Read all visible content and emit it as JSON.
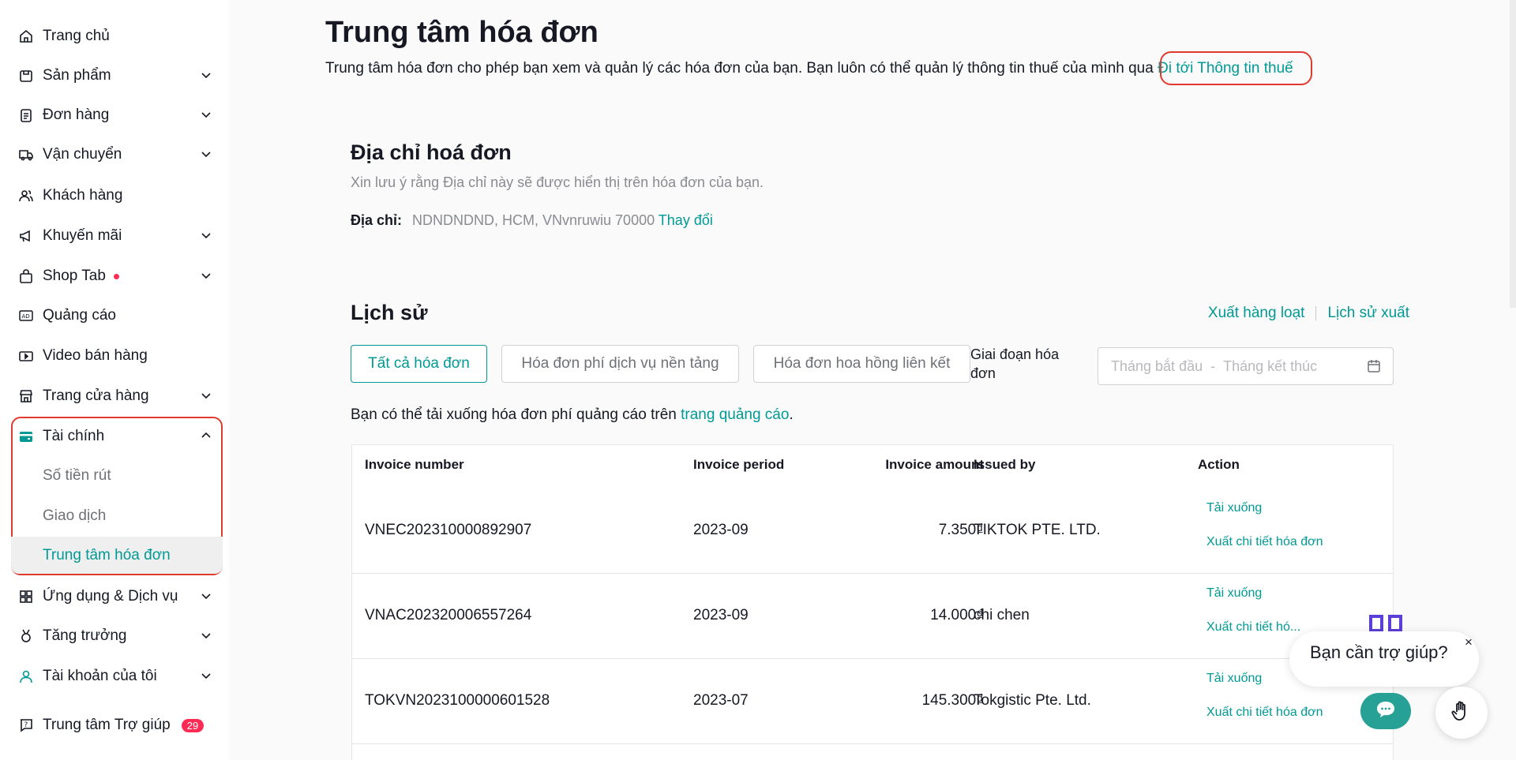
{
  "sidebar": {
    "items": [
      {
        "label": "Trang chủ",
        "icon": "home-icon"
      },
      {
        "label": "Sản phẩm",
        "icon": "product-icon"
      },
      {
        "label": "Đơn hàng",
        "icon": "order-icon"
      },
      {
        "label": "Vận chuyển",
        "icon": "truck-icon"
      },
      {
        "label": "Khách hàng",
        "icon": "customers-icon"
      },
      {
        "label": "Khuyến mãi",
        "icon": "megaphone-icon"
      },
      {
        "label": "Shop Tab",
        "icon": "shop-bag-icon"
      },
      {
        "label": "Quảng cáo",
        "icon": "ad-icon"
      },
      {
        "label": "Video bán hàng",
        "icon": "video-icon"
      },
      {
        "label": "Trang cửa hàng",
        "icon": "storefront-icon"
      },
      {
        "label": "Tài chính",
        "icon": "wallet-icon"
      },
      {
        "label": "Ứng dụng & Dịch vụ",
        "icon": "apps-icon"
      },
      {
        "label": "Tăng trưởng",
        "icon": "growth-medal-icon"
      },
      {
        "label": "Tài khoản của tôi",
        "icon": "account-icon"
      },
      {
        "label": "Trung tâm Trợ giúp",
        "icon": "help-icon"
      }
    ],
    "finance_sub": [
      "Số tiền rút",
      "Giao dịch",
      "Trung tâm hóa đơn"
    ],
    "help_badge": "29"
  },
  "header": {
    "title": "Trung tâm hóa đơn",
    "desc": "Trung tâm hóa đơn cho phép bạn xem và quản lý các hóa đơn của bạn. Bạn luôn có thể quản lý thông tin thuế của mình qua",
    "tax_link": "Đi tới Thông tin thuế"
  },
  "billing": {
    "title": "Địa chỉ hoá đơn",
    "note": "Xin lưu ý rằng Địa chỉ này sẽ được hiển thị trên hóa đơn của bạn.",
    "address_label": "Địa chỉ:",
    "address_value": "NDNDNDND, HCM, VNvnruwiu 70000",
    "change": "Thay đổi"
  },
  "history": {
    "title": "Lịch sử",
    "bulk_export": "Xuất hàng loạt",
    "export_history": "Lịch sử xuất",
    "tabs": [
      "Tất cả hóa đơn",
      "Hóa đơn phí dịch vụ nền tảng",
      "Hóa đơn hoa hồng liên kết"
    ],
    "period_label": "Giai đoạn hóa đơn",
    "start_placeholder": "Tháng bắt đầu",
    "end_placeholder": "Tháng kết thúc",
    "ads_note_prefix": "Bạn có thể tải xuống hóa đơn phí quảng cáo trên ",
    "ads_link": "trang quảng cáo",
    "ads_note_suffix": "."
  },
  "table": {
    "columns": [
      "Invoice number",
      "Invoice period",
      "Invoice amount",
      "Issued by",
      "Action"
    ],
    "rows": [
      {
        "number": "VNEC202310000892907",
        "period": "2023-09",
        "amount": "7.350₫",
        "issuer": "TIKTOK PTE. LTD.",
        "download": "Tải xuống",
        "export": "Xuất chi tiết hóa đơn"
      },
      {
        "number": "VNAC202320006557264",
        "period": "2023-09",
        "amount": "14.000₫",
        "issuer": "chi chen",
        "download": "Tải xuống",
        "export": "Xuất chi tiết hó..."
      },
      {
        "number": "TOKVN2023100000601528",
        "period": "2023-07",
        "amount": "145.300₫",
        "issuer": "Tokgistic Pte. Ltd.",
        "download": "Tải xuống",
        "export": "Xuất chi tiết hóa đơn"
      }
    ]
  },
  "help_widget": {
    "text": "Bạn cần trợ giúp?",
    "close": "×"
  },
  "colors": {
    "accent": "#009995",
    "highlight_box": "#e03a2e",
    "badge": "#fe2c55"
  }
}
